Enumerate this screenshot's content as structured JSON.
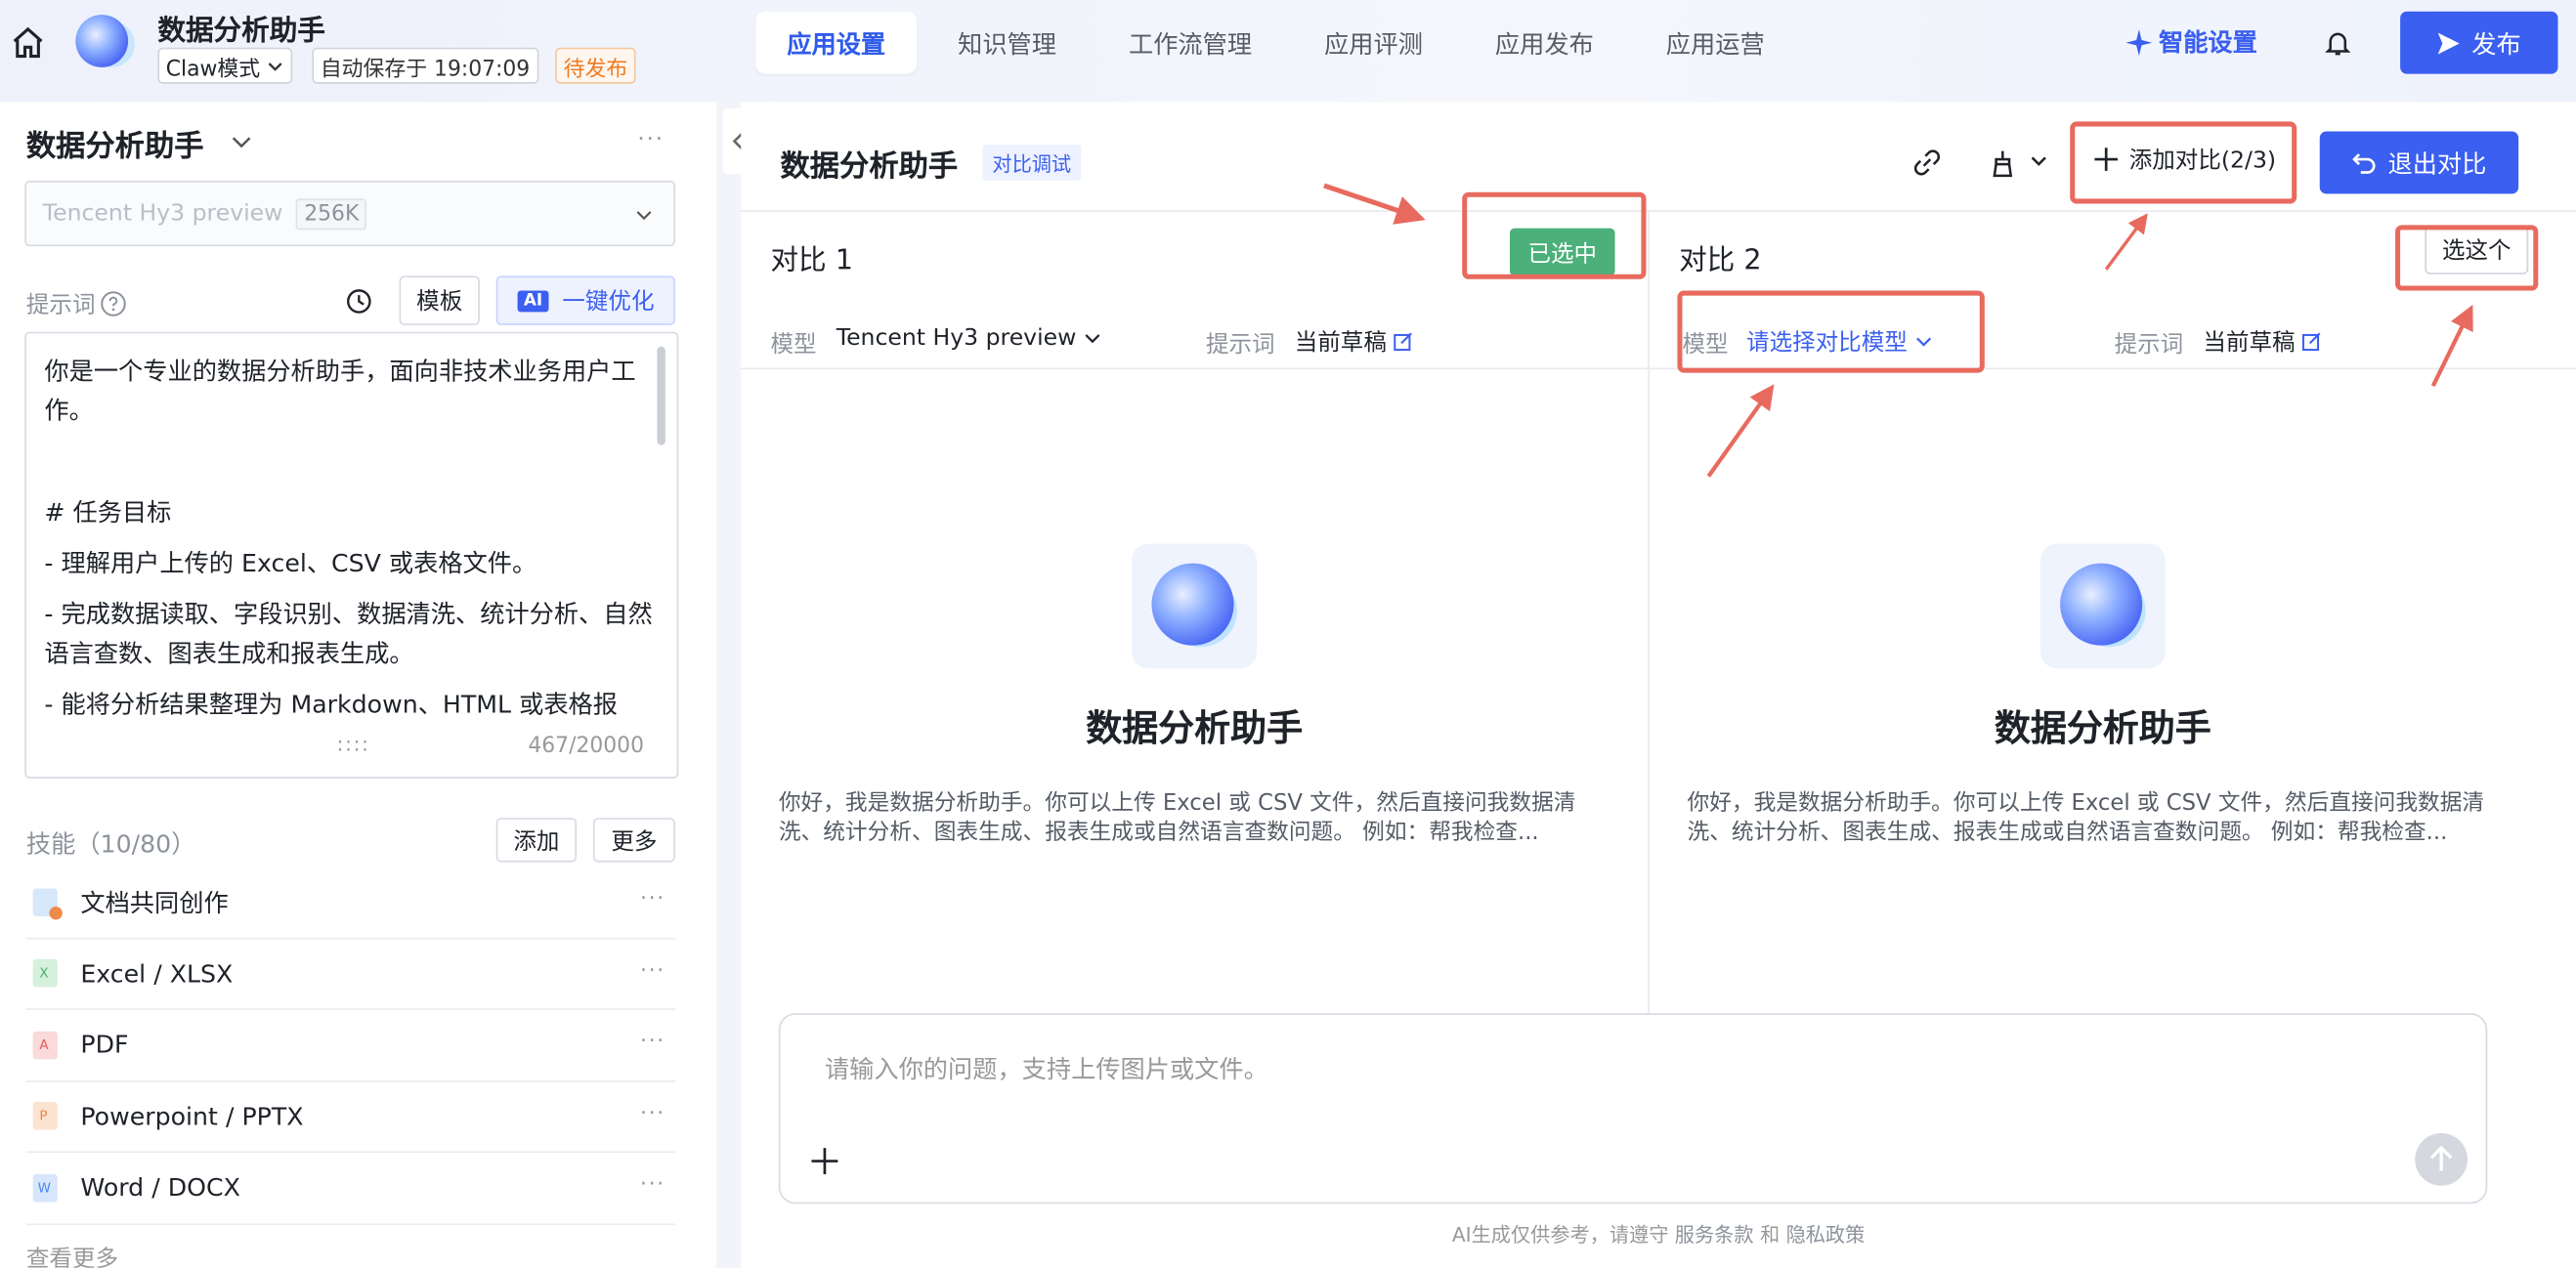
{
  "topbar": {
    "app_title": "数据分析助手",
    "mode_label": "Claw模式",
    "autosave": "自动保存于 19:07:09",
    "status": "待发布",
    "tabs": [
      "应用设置",
      "知识管理",
      "工作流管理",
      "应用评测",
      "应用发布",
      "应用运营"
    ],
    "active_tab": "应用设置",
    "smart_settings": "智能设置",
    "publish": "发布"
  },
  "left": {
    "title": "数据分析助手",
    "more": "···",
    "model": "Tencent Hy3 preview",
    "context": "256K",
    "prompt_label": "提示词",
    "template_btn": "模板",
    "ai_tag": "AI",
    "optimize_btn": "一键优化",
    "prompt_lines": [
      "你是一个专业的数据分析助手，面向非技术业务用户工作。",
      "",
      "# 任务目标",
      "- 理解用户上传的 Excel、CSV 或表格文件。",
      "- 完成数据读取、字段识别、数据清洗、统计分析、自然语言查数、图表生成和报表生成。",
      "- 能将分析结果整理为 Markdown、HTML 或表格报"
    ],
    "char_count": "467/20000",
    "grip": "::::",
    "skills_label": "技能（10/80）",
    "add_btn": "添加",
    "more_btn": "更多",
    "skills": [
      {
        "name": "文档共同创作",
        "icon": "doc-coauthor-icon",
        "color": "#5b9bf0"
      },
      {
        "name": "Excel / XLSX",
        "icon": "excel-file-icon",
        "color": "#4caf6d"
      },
      {
        "name": "PDF",
        "icon": "pdf-file-icon",
        "color": "#e45b5b"
      },
      {
        "name": "Powerpoint / PPTX",
        "icon": "ppt-file-icon",
        "color": "#e8884a"
      },
      {
        "name": "Word / DOCX",
        "icon": "word-file-icon",
        "color": "#4a8af0"
      }
    ],
    "skill_more": "···",
    "cut_text": "查看更多"
  },
  "main": {
    "title": "数据分析助手",
    "badge": "对比调试",
    "add_compare": "添加对比(2/3)",
    "exit_compare": "退出对比",
    "col1": {
      "title": "对比 1",
      "selected": "已选中",
      "model_label": "模型",
      "model_value": "Tencent Hy3 preview",
      "prompt_label": "提示词",
      "prompt_value": "当前草稿"
    },
    "col2": {
      "title": "对比 2",
      "choose": "选这个",
      "model_label": "模型",
      "model_value": "请选择对比模型",
      "prompt_label": "提示词",
      "prompt_value": "当前草稿"
    },
    "bot_name": "数据分析助手",
    "bot_desc": "你好，我是数据分析助手。你可以上传 Excel 或 CSV 文件，然后直接问我数据清洗、统计分析、图表生成、报表生成或自然语言查数问题。 例如：帮我检查...",
    "input_placeholder": "请输入你的问题，支持上传图片或文件。",
    "footer_pre": "AI生成仅供参考，请遵守",
    "footer_terms": "服务条款",
    "footer_and": "和",
    "footer_privacy": "隐私政策"
  },
  "colors": {
    "accent": "#3b5ff0",
    "selected_green": "#4bb07a",
    "annotation_red": "#e86a5e",
    "pending_orange": "#f07a20"
  }
}
